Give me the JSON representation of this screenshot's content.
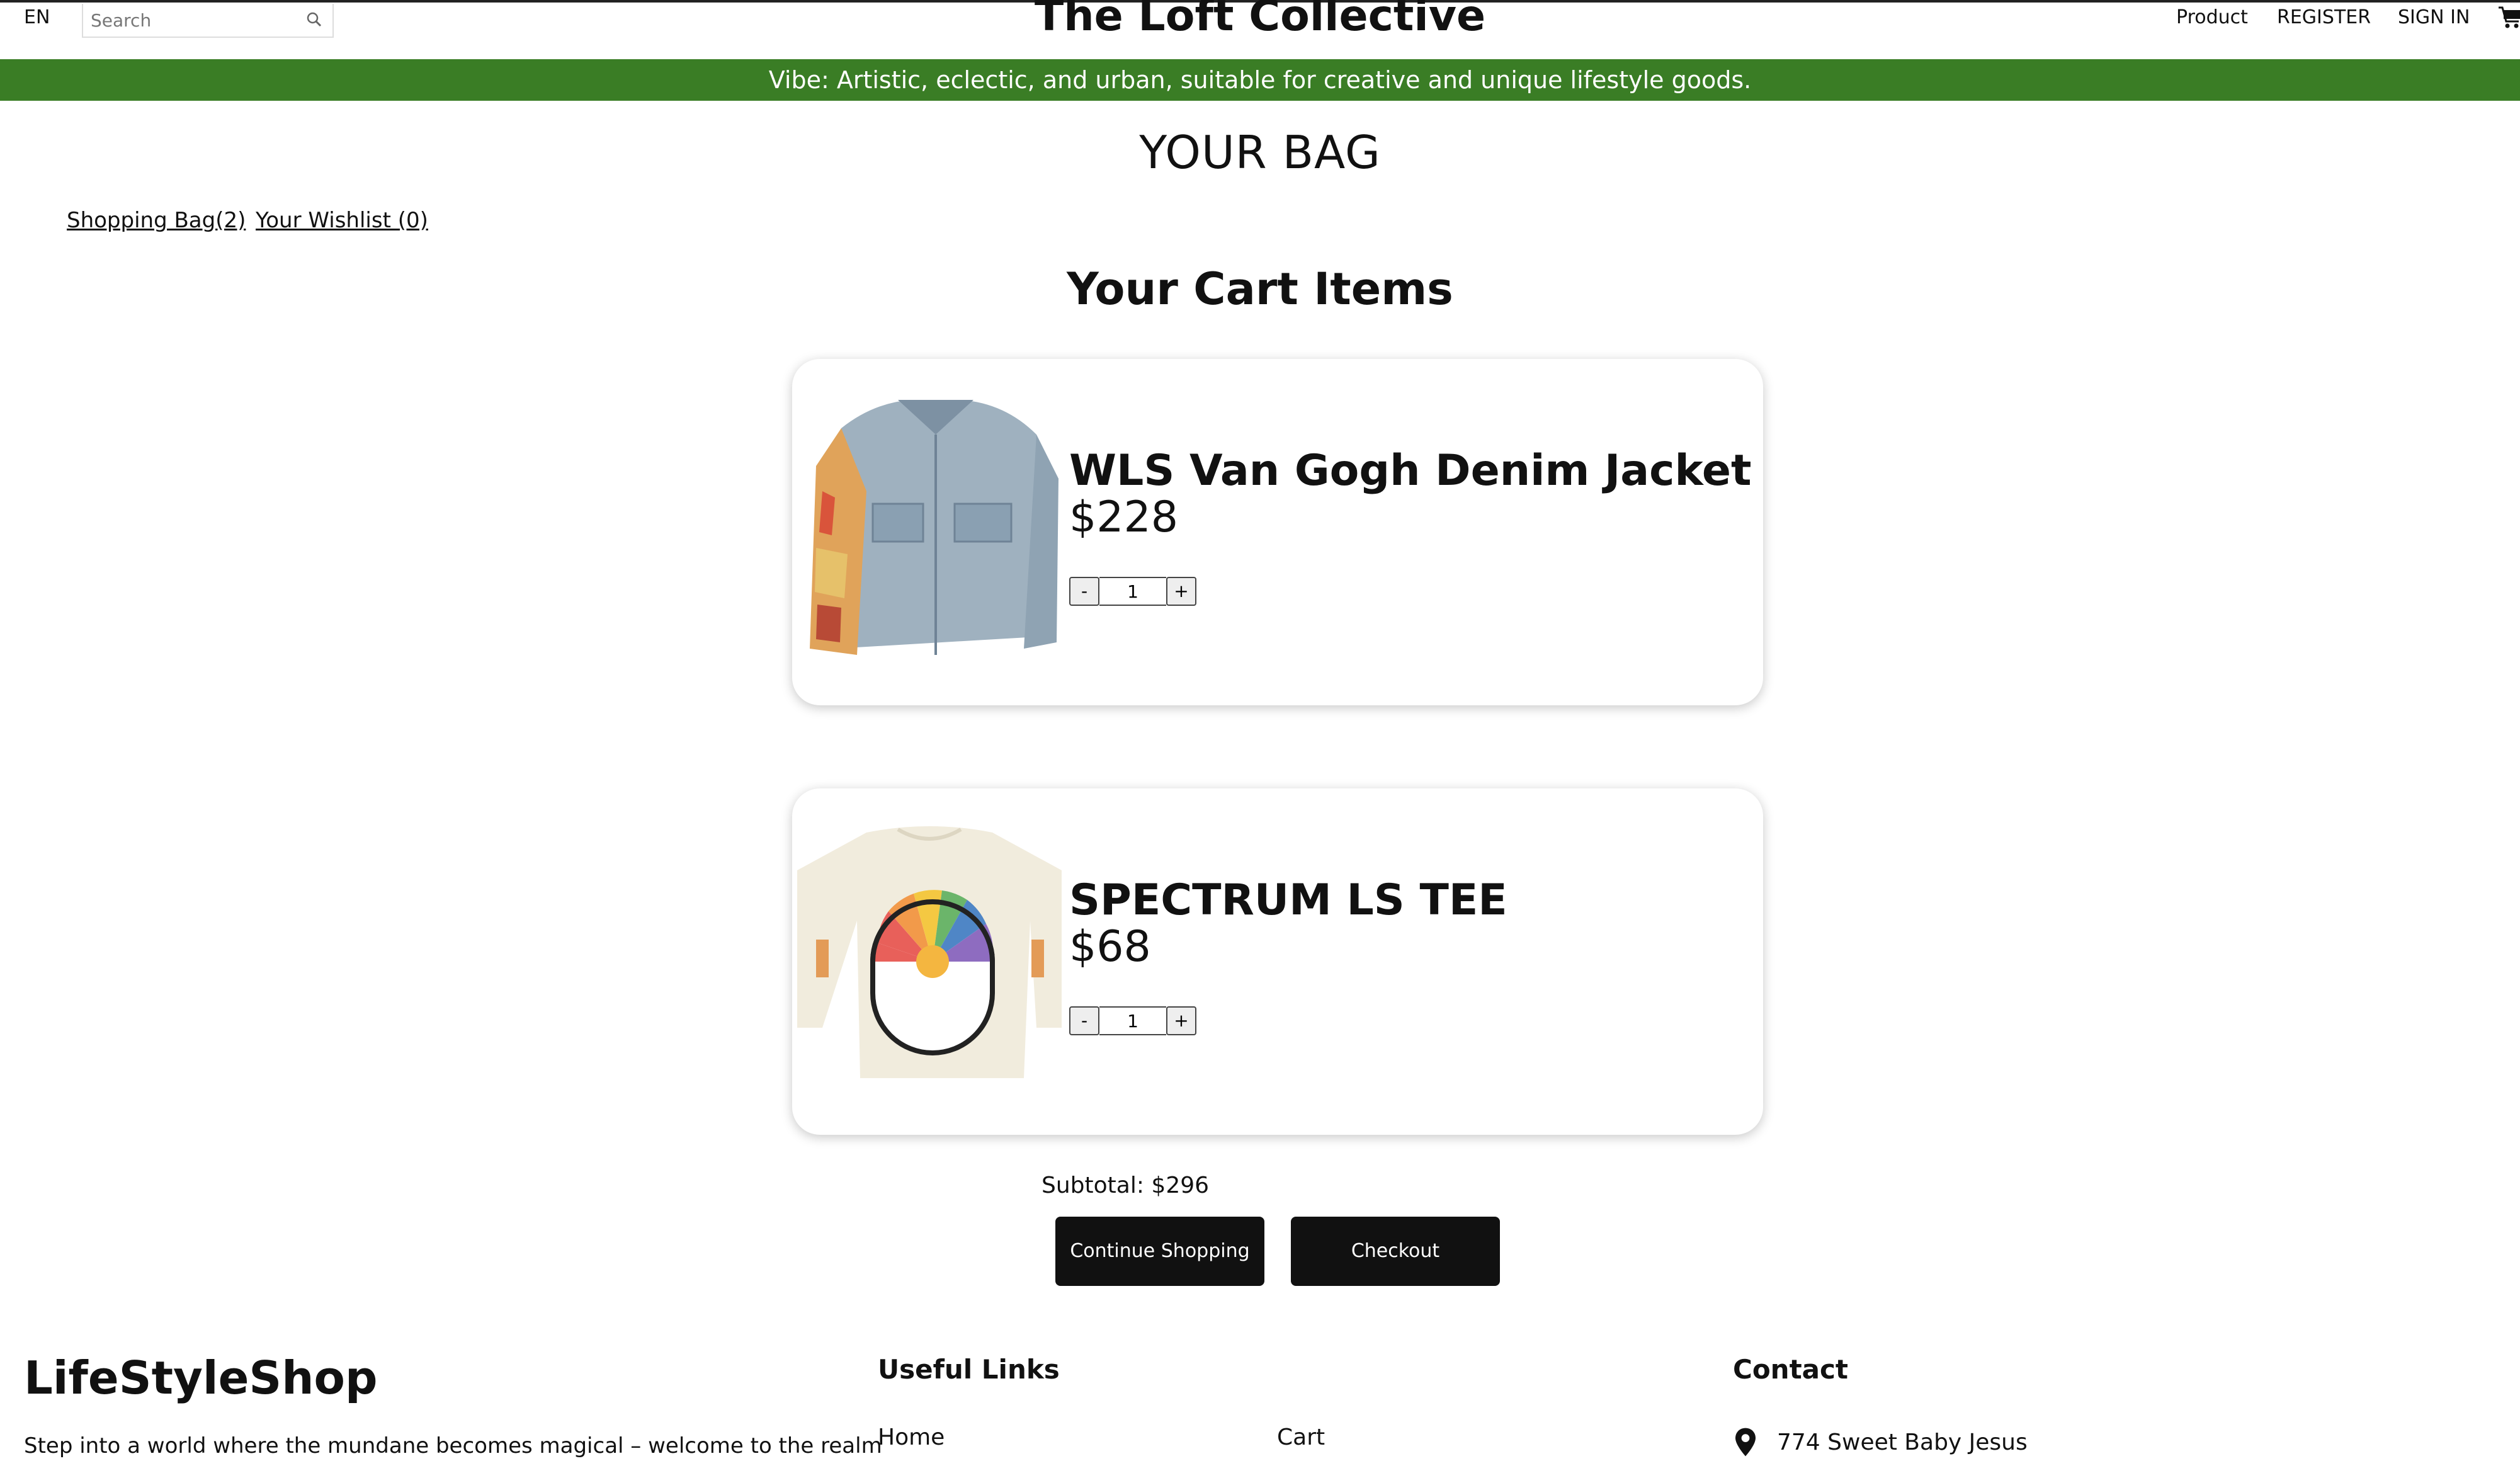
{
  "header": {
    "language": "EN",
    "search_placeholder": "Search",
    "site_title": "The Loft Collective",
    "nav": [
      "Product",
      "REGISTER",
      "SIGN IN"
    ]
  },
  "banner": {
    "text": "Vibe: Artistic, eclectic, and urban, suitable for creative and unique lifestyle goods."
  },
  "page": {
    "heading": "YOUR BAG",
    "tabs": {
      "bag": "Shopping Bag(2)",
      "wishlist": "Your Wishlist (0)"
    },
    "section_title": "Your Cart Items"
  },
  "cart": {
    "items": [
      {
        "name": "WLS Van Gogh Denim Jacket",
        "price": "$228",
        "quantity": "1"
      },
      {
        "name": "SPECTRUM LS TEE",
        "price": "$68",
        "quantity": "1"
      }
    ],
    "qty_minus": "-",
    "qty_plus": "+",
    "subtotal": "Subtotal: $296",
    "continue_label": "Continue Shopping",
    "checkout_label": "Checkout"
  },
  "footer": {
    "brand": "LifeStyleShop",
    "tagline": "Step into a world where the mundane becomes magical – welcome to the realm",
    "useful_links_title": "Useful Links",
    "links": [
      "Home",
      "Cart"
    ],
    "contact_title": "Contact",
    "address": "774 Sweet Baby Jesus"
  },
  "colors": {
    "banner": "#3a7d25",
    "button": "#111111"
  },
  "icons": [
    "search-icon",
    "cart-icon",
    "location-pin-icon"
  ]
}
